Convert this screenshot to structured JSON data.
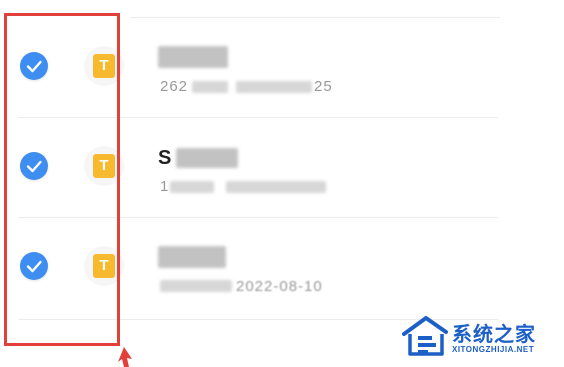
{
  "colors": {
    "check_blue": "#3d8ef0",
    "doc_icon_yellow": "#f7b92d",
    "highlight_red": "#e2403a",
    "watermark_blue": "#1c5fc6"
  },
  "files": [
    {
      "selected": true,
      "icon": "text-document-icon",
      "icon_glyph": "T",
      "title": "",
      "meta_prefix": "262",
      "meta_suffix": "25"
    },
    {
      "selected": true,
      "icon": "text-document-icon",
      "icon_glyph": "T",
      "title": "S",
      "meta_prefix": "1",
      "meta_suffix": ""
    },
    {
      "selected": true,
      "icon": "text-document-icon",
      "icon_glyph": "T",
      "title": "",
      "meta_prefix": "",
      "meta_suffix": "2022-08-10"
    }
  ],
  "watermark": {
    "title": "系统之家",
    "url": "XITONGZHIJIA.NET"
  }
}
